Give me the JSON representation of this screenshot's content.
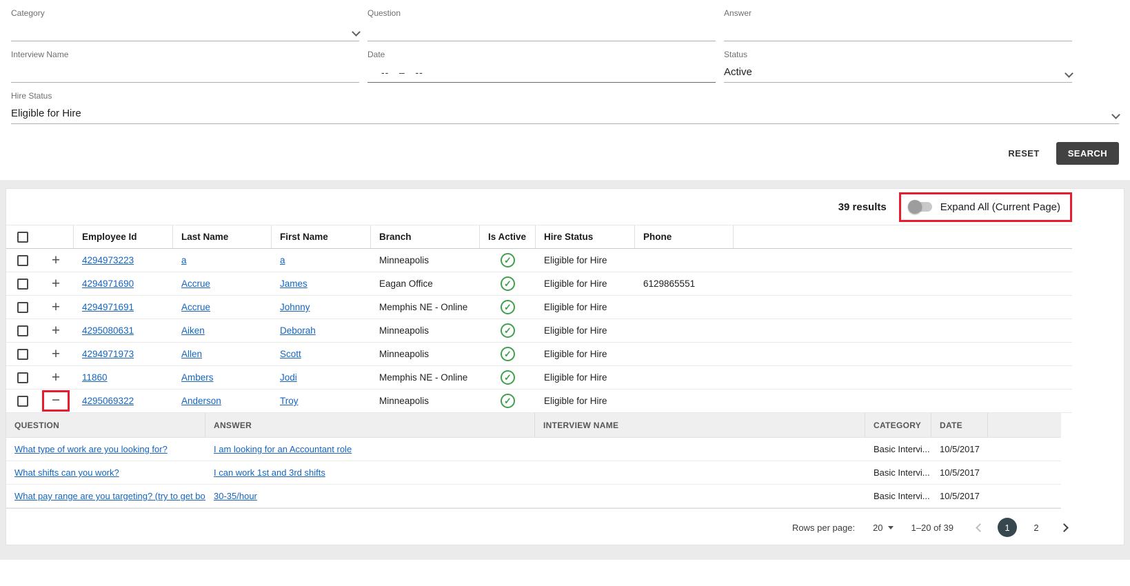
{
  "colors": {
    "link_blue": "#1565c0",
    "active_green": "#3da14a",
    "annotation_red": "#e81c2e",
    "search_button_dark": "#424242",
    "active_page_circle": "#37474f"
  },
  "icons": {
    "expand": "+",
    "collapse": "−",
    "active_check": "✓"
  },
  "filters": {
    "category": {
      "label": "Category",
      "value": ""
    },
    "question": {
      "label": "Question",
      "value": ""
    },
    "answer": {
      "label": "Answer",
      "value": ""
    },
    "interview_name": {
      "label": "Interview Name",
      "value": ""
    },
    "date": {
      "label": "Date",
      "value": "--   –   --"
    },
    "status": {
      "label": "Status",
      "value": "Active"
    },
    "hire_status": {
      "label": "Hire Status",
      "value": "Eligible for Hire"
    },
    "reset_label": "RESET",
    "search_label": "SEARCH"
  },
  "results": {
    "count_text": "39 results",
    "expand_all_label": "Expand All (Current Page)",
    "table": {
      "headers": {
        "employee_id": "Employee Id",
        "last_name": "Last Name",
        "first_name": "First Name",
        "branch": "Branch",
        "is_active": "Is Active",
        "hire_status": "Hire Status",
        "phone": "Phone"
      },
      "rows": [
        {
          "employee_id": "4294973223",
          "last_name": "a",
          "first_name": "a",
          "branch": "Minneapolis",
          "is_active": true,
          "hire_status": "Eligible for Hire",
          "phone": "",
          "expanded": false
        },
        {
          "employee_id": "4294971690",
          "last_name": "Accrue",
          "first_name": "James",
          "branch": "Eagan Office",
          "is_active": true,
          "hire_status": "Eligible for Hire",
          "phone": "6129865551",
          "expanded": false
        },
        {
          "employee_id": "4294971691",
          "last_name": "Accrue",
          "first_name": "Johnny",
          "branch": "Memphis NE - Online",
          "is_active": true,
          "hire_status": "Eligible for Hire",
          "phone": "",
          "expanded": false
        },
        {
          "employee_id": "4295080631",
          "last_name": "Aiken",
          "first_name": "Deborah",
          "branch": "Minneapolis",
          "is_active": true,
          "hire_status": "Eligible for Hire",
          "phone": "",
          "expanded": false
        },
        {
          "employee_id": "4294971973",
          "last_name": "Allen",
          "first_name": "Scott",
          "branch": "Minneapolis",
          "is_active": true,
          "hire_status": "Eligible for Hire",
          "phone": "",
          "expanded": false
        },
        {
          "employee_id": "11860",
          "last_name": "Ambers",
          "first_name": "Jodi",
          "branch": "Memphis NE - Online",
          "is_active": true,
          "hire_status": "Eligible for Hire",
          "phone": "",
          "expanded": false
        },
        {
          "employee_id": "4295069322",
          "last_name": "Anderson",
          "first_name": "Troy",
          "branch": "Minneapolis",
          "is_active": true,
          "hire_status": "Eligible for Hire",
          "phone": "",
          "expanded": true
        }
      ]
    },
    "detail": {
      "headers": {
        "question": "QUESTION",
        "answer": "ANSWER",
        "interview_name": "INTERVIEW NAME",
        "category": "CATEGORY",
        "date": "DATE"
      },
      "rows": [
        {
          "question": "What type of work are you looking for?",
          "answer": "I am looking for an Accountant role",
          "interview_name": "",
          "category": "Basic Intervi...",
          "date": "10/5/2017"
        },
        {
          "question": "What shifts can you work?",
          "answer": "I can work 1st and 3rd shifts",
          "interview_name": "",
          "category": "Basic Intervi...",
          "date": "10/5/2017"
        },
        {
          "question": "What pay range are you targeting? (try to get bot...",
          "answer": "30-35/hour",
          "interview_name": "",
          "category": "Basic Intervi...",
          "date": "10/5/2017"
        }
      ]
    }
  },
  "pagination": {
    "rows_per_page_label": "Rows per page:",
    "rows_per_page_value": "20",
    "range_text": "1–20 of 39",
    "pages": [
      "1",
      "2"
    ]
  }
}
